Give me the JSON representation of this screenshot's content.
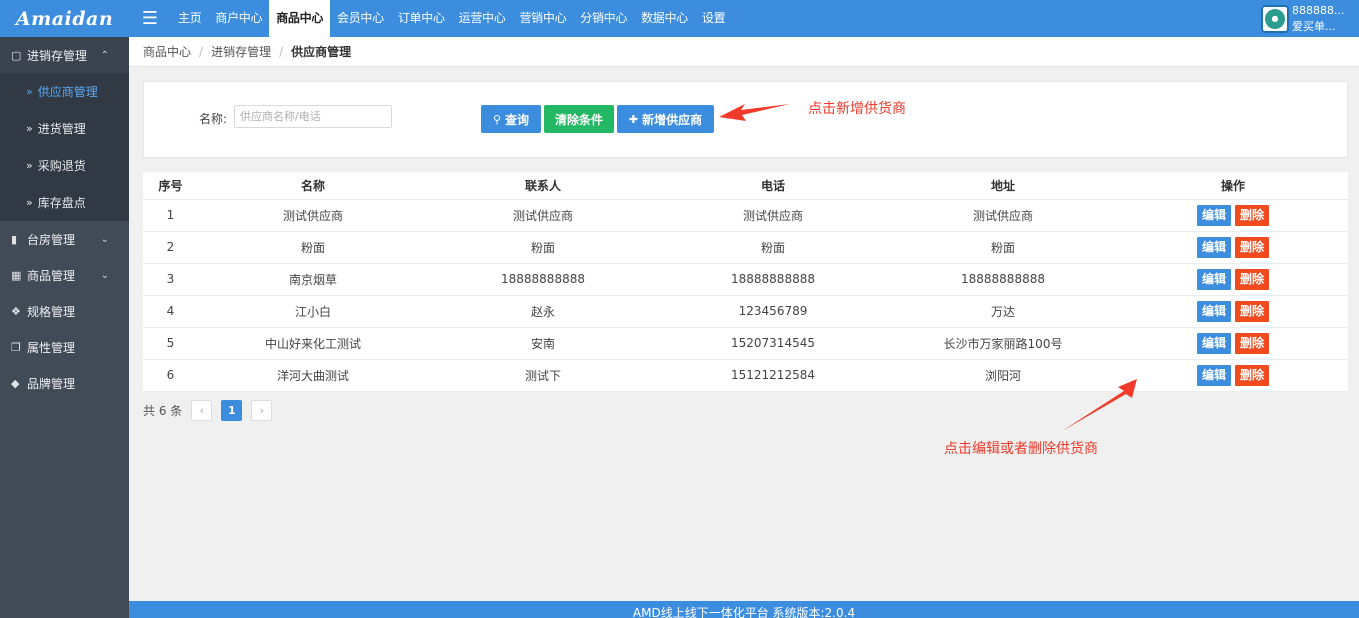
{
  "app": {
    "logo": "Amaidan",
    "user": {
      "id": "888888...",
      "name": "爱买单..."
    }
  },
  "nav": {
    "items": [
      {
        "label": "主页"
      },
      {
        "label": "商户中心"
      },
      {
        "label": "商品中心",
        "active": true
      },
      {
        "label": "会员中心"
      },
      {
        "label": "订单中心"
      },
      {
        "label": "运营中心"
      },
      {
        "label": "营销中心"
      },
      {
        "label": "分销中心"
      },
      {
        "label": "数据中心"
      },
      {
        "label": "设置"
      }
    ]
  },
  "sidebar": {
    "groups": [
      {
        "label": "进销存管理",
        "icon": "map-icon",
        "expanded": true,
        "items": [
          {
            "label": "供应商管理",
            "active": true
          },
          {
            "label": "进货管理"
          },
          {
            "label": "采购退货"
          },
          {
            "label": "库存盘点"
          }
        ]
      },
      {
        "label": "台房管理",
        "icon": "bookmark-icon"
      },
      {
        "label": "商品管理",
        "icon": "grid-icon"
      },
      {
        "label": "规格管理",
        "icon": "cubes-icon"
      },
      {
        "label": "属性管理",
        "icon": "cube-icon"
      },
      {
        "label": "品牌管理",
        "icon": "tags-icon"
      }
    ]
  },
  "breadcrumb": [
    "商品中心",
    "进销存管理",
    "供应商管理"
  ],
  "search": {
    "label": "名称:",
    "placeholder": "供应商名称/电话",
    "value": "",
    "query_label": "查询",
    "clear_label": "清除条件",
    "add_label": "新增供应商"
  },
  "annotations": {
    "add_hint": "点击新增供货商",
    "edit_hint": "点击编辑或者删除供货商"
  },
  "table": {
    "columns": [
      "序号",
      "名称",
      "联系人",
      "电话",
      "地址",
      "操作"
    ],
    "edit_label": "编辑",
    "delete_label": "删除",
    "rows": [
      [
        "1",
        "测试供应商",
        "测试供应商",
        "测试供应商",
        "测试供应商"
      ],
      [
        "2",
        "粉面",
        "粉面",
        "粉面",
        "粉面"
      ],
      [
        "3",
        "南京烟草",
        "18888888888",
        "18888888888",
        "18888888888"
      ],
      [
        "4",
        "江小白",
        "赵永",
        "123456789",
        "万达"
      ],
      [
        "5",
        "中山好来化工测试",
        "安南",
        "15207314545",
        "长沙市万家丽路100号"
      ],
      [
        "6",
        "洋河大曲测试",
        "测试下",
        "15121212584",
        "浏阳河"
      ]
    ]
  },
  "pager": {
    "total_text": "共 6 条",
    "current_page": "1",
    "prev": "‹",
    "next": "›"
  },
  "footer": {
    "text": "AMD线上线下一体化平台 系统版本:2.0.4"
  },
  "colors": {
    "primary": "#3c8dde",
    "success": "#22b864",
    "danger": "#f04a1e",
    "sidebar": "#414b58",
    "annotation": "#f03a2a"
  }
}
